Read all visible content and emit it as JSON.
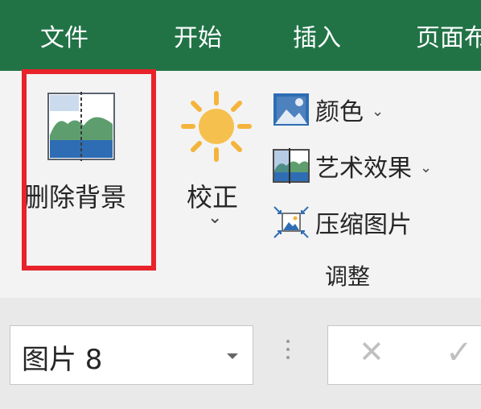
{
  "tabs": [
    {
      "label": "文件"
    },
    {
      "label": "开始"
    },
    {
      "label": "插入"
    },
    {
      "label": "页面布"
    }
  ],
  "ribbon": {
    "remove_background": {
      "label": "删除背景",
      "icon": "remove-background-icon"
    },
    "corrections": {
      "label": "校正",
      "caret": "⌄",
      "icon": "sun-icon"
    },
    "color": {
      "label": "颜色",
      "caret": "⌄",
      "icon": "color-picture-icon"
    },
    "artistic_effects": {
      "label": "艺术效果",
      "caret": "⌄",
      "icon": "artistic-effects-icon"
    },
    "compress_pictures": {
      "label": "压缩图片",
      "icon": "compress-pictures-icon"
    },
    "group_label": "调整",
    "highlight_color": "#e8232a"
  },
  "formula_bar": {
    "name_box_value": "图片 8",
    "cancel_symbol": "✕",
    "enter_symbol": "✓"
  },
  "colors": {
    "tab_bar": "#217346",
    "ribbon_bg": "#f3f3f3",
    "icon_blue": "#2e6db4",
    "icon_green": "#5e9e6e",
    "sun": "#f4b43c"
  }
}
